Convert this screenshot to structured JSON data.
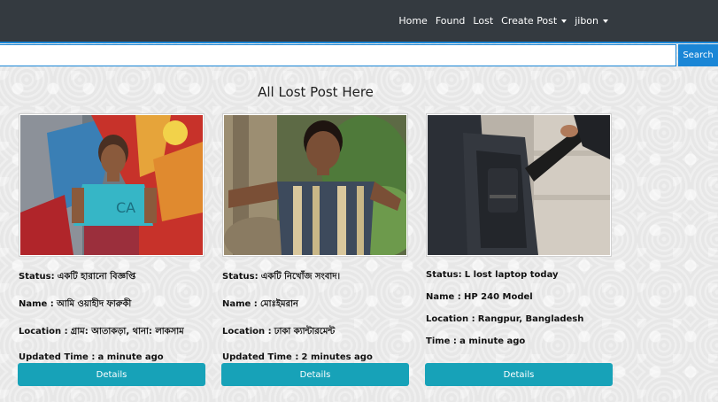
{
  "nav": {
    "items": [
      {
        "label": "Home"
      },
      {
        "label": "Found"
      },
      {
        "label": "Lost"
      },
      {
        "label": "Create Post"
      },
      {
        "label": "jibon"
      }
    ]
  },
  "search": {
    "value": "",
    "button_label": "Search"
  },
  "page_title": "All Lost Post Here",
  "posts": [
    {
      "status_label": "Status:",
      "status": "একটি হারানো বিজ্ঞপ্তি",
      "name_label": "Name :",
      "name": "আমি ওয়াহীদ ফারুকী",
      "location_label": "Location :",
      "location": "গ্রাম: আতাকড়া, থানা: লাকসাম",
      "time_label": "Updated Time :",
      "time": "a minute ago",
      "button": "Details"
    },
    {
      "status_label": "Status:",
      "status": "একটি নিখোঁজ সংবাদ।",
      "name_label": "Name :",
      "name": "মোঃইমরান",
      "location_label": "Location :",
      "location": "ঢাকা ক্যান্টারমেন্ট",
      "time_label": "Updated Time :",
      "time": "2 minutes ago",
      "button": "Details"
    },
    {
      "status_label": "Status:",
      "status": "L lost laptop today",
      "name_label": "Name :",
      "name": "HP 240 Model",
      "location_label": "Location :",
      "location": "Rangpur, Bangladesh",
      "time_label": "Time :",
      "time": "a minute ago",
      "button": "Details"
    }
  ]
}
